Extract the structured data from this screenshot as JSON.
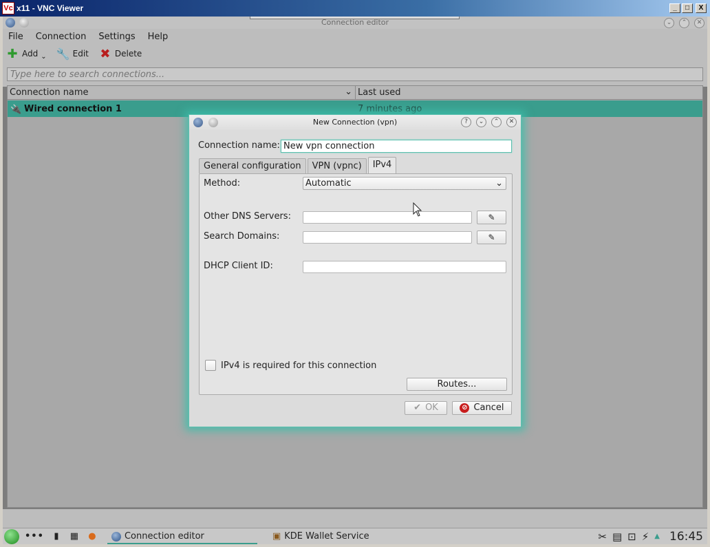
{
  "vnc": {
    "logo": "Vc",
    "title": "x11 - VNC Viewer",
    "controls": [
      "_",
      "□",
      "X"
    ]
  },
  "kde_window": {
    "title": "Connection editor",
    "menu": [
      "File",
      "Connection",
      "Settings",
      "Help"
    ],
    "toolbar": {
      "add": "Add",
      "edit": "Edit",
      "delete": "Delete"
    },
    "search_placeholder": "Type here to search connections...",
    "list": {
      "col_name": "Connection name",
      "col_used": "Last used",
      "rows": [
        {
          "name": "Wired connection 1",
          "last_used": "7 minutes ago"
        }
      ]
    }
  },
  "dialog": {
    "title": "New Connection (vpn)",
    "title_buttons": [
      "?",
      "⌄",
      "⌃",
      "✕"
    ],
    "connection_name_label": "Connection name:",
    "connection_name_value": "New vpn connection",
    "tabs": [
      "General configuration",
      "VPN (vpnc)",
      "IPv4"
    ],
    "active_tab": "IPv4",
    "method_label": "Method:",
    "method_value": "Automatic",
    "dns_label": "Other DNS Servers:",
    "search_domains_label": "Search Domains:",
    "dhcp_label": "DHCP Client ID:",
    "ipv4_required_label": "IPv4 is required for this connection",
    "routes_label": "Routes...",
    "ok_label": "OK",
    "cancel_label": "Cancel"
  },
  "taskbar": {
    "tasks": [
      "Connection editor",
      "KDE Wallet Service"
    ],
    "clock": "16:45"
  },
  "colors": {
    "accent": "#3a9d8d",
    "glow": "#5bbfae"
  }
}
